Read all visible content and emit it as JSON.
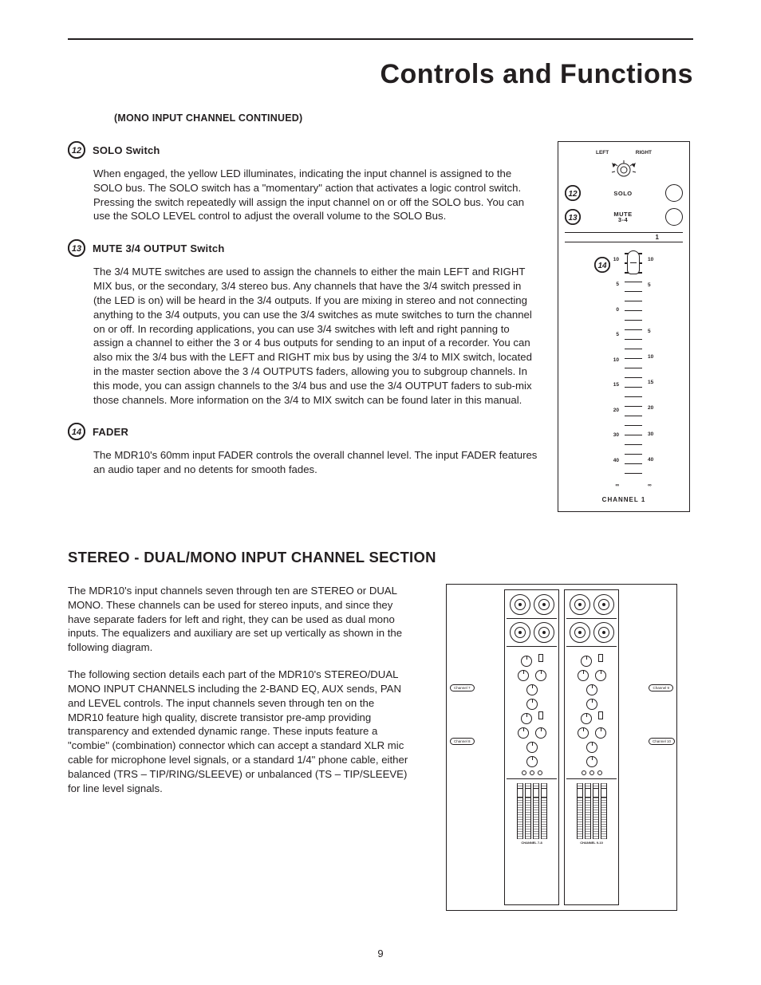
{
  "page": {
    "title": "Controls and Functions",
    "continued": "(MONO INPUT CHANNEL CONTINUED)",
    "page_number": "9"
  },
  "items": [
    {
      "num": "12",
      "title": "SOLO Switch",
      "body": "When engaged, the yellow LED illuminates, indicating the input channel is assigned to the SOLO bus. The SOLO switch has a \"momentary\" action that activates a logic control switch. Pressing the switch repeatedly will assign the input channel on or off the SOLO bus. You can use the SOLO LEVEL control to adjust the overall volume to the SOLO Bus."
    },
    {
      "num": "13",
      "title": "MUTE 3/4 OUTPUT Switch",
      "body": "The 3/4 MUTE switches are used to assign the channels to either the main LEFT and RIGHT MIX bus, or the secondary, 3/4 stereo bus. Any channels that have the 3/4 switch pressed in (the LED is on) will be heard in the 3/4 outputs. If you are mixing in stereo and not connecting anything to the 3/4 outputs, you can use the 3/4 switches as  mute switches to turn the channel on or off. In recording applications, you can use 3/4 switches with left and right panning to assign a channel to either the 3 or 4 bus outputs for sending to an input of a recorder. You can also mix the 3/4 bus with the LEFT and RIGHT mix bus by using the 3/4 to MIX switch, located in the master section above the 3 /4 OUTPUTS faders, allowing you to subgroup channels. In this mode, you can assign channels to the 3/4 bus and use the 3/4 OUTPUT faders to sub-mix those channels. More information on the 3/4 to MIX switch can be found later in this manual."
    },
    {
      "num": "14",
      "title": "FADER",
      "body": "The MDR10's 60mm input FADER controls the overall channel level.  The input FADER features an audio taper and no detents for smooth fades."
    }
  ],
  "section2": {
    "title": "STEREO - DUAL/MONO INPUT CHANNEL SECTION",
    "p1": "The MDR10's input channels seven through ten are STEREO or DUAL MONO. These channels can be used for stereo inputs, and since they have separate faders for left and right, they can be used as dual mono inputs.  The equalizers and auxiliary are set up vertically as shown in the following diagram.",
    "p2": "The following section details each part of the MDR10's STEREO/DUAL MONO INPUT CHANNELS including the 2-BAND EQ, AUX sends, PAN and LEVEL controls. The input channels seven through ten on the MDR10 feature high quality, discrete transistor pre-amp providing transparency and extended dynamic range.  These inputs feature a \"combie\" (combination) connector which can accept a standard XLR mic cable for microphone level signals, or a standard 1/4\" phone cable, either balanced (TRS – TIP/RING/SLEEVE) or unbalanced (TS – TIP/SLEEVE) for line level signals."
  },
  "strip": {
    "pan_left": "LEFT",
    "pan_right": "RIGHT",
    "solo": "SOLO",
    "mute": "MUTE\n3-4",
    "ch_num": "1",
    "scale_left": [
      "10",
      "5",
      "0",
      "5",
      "10",
      "15",
      "20",
      "30",
      "40",
      "∞"
    ],
    "scale_right": [
      "10",
      "5",
      "",
      "5",
      "10",
      "15",
      "20",
      "30",
      "40",
      "∞"
    ],
    "footer": "CHANNEL 1"
  },
  "stereo_diagram": {
    "ch7": "Channel 7",
    "ch8": "Channel 8",
    "ch9": "Channel 9",
    "ch10": "Channel 10",
    "bl": "CHANNEL 7-8",
    "br": "CHANNEL 9-10"
  }
}
